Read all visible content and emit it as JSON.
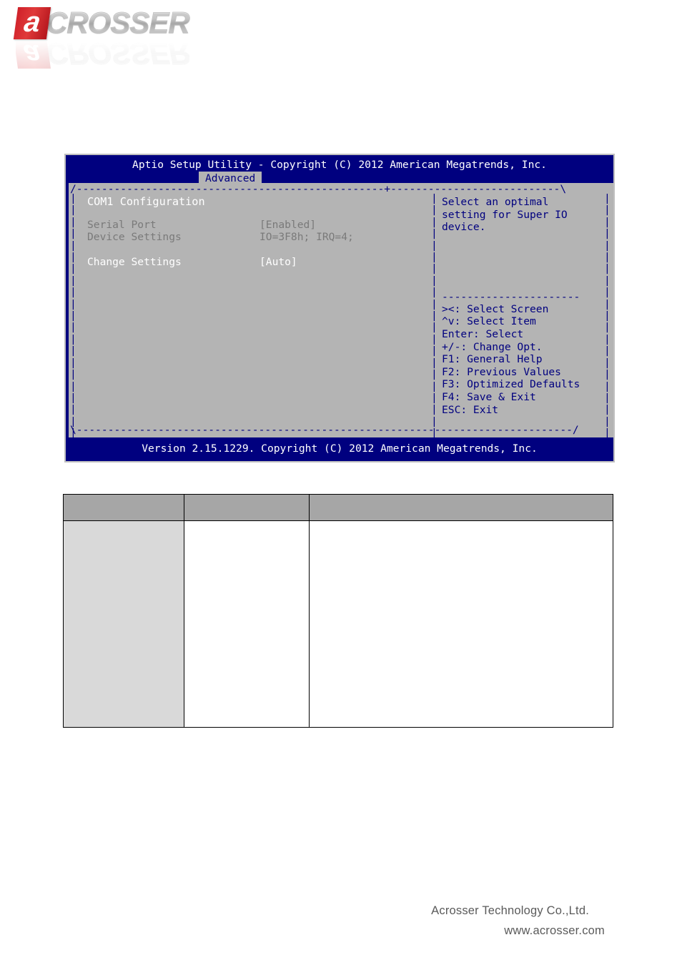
{
  "logo": {
    "mark_letter": "a",
    "wordmark": "CROSSER",
    "alt": "acrosser"
  },
  "bios": {
    "title": "Aptio Setup Utility - Copyright (C) 2012 American Megatrends, Inc.",
    "active_tab": "Advanced",
    "tabs": [
      "Advanced"
    ],
    "section_title": "COM1 Configuration",
    "options": [
      {
        "label": "Serial Port",
        "value": "[Enabled]",
        "state": "dim"
      },
      {
        "label": "Device Settings",
        "value": "IO=3F8h; IRQ=4;",
        "state": "dim"
      },
      {
        "label": "Change Settings",
        "value": "[Auto]",
        "state": "active"
      }
    ],
    "help_text": "Select an optimal\nsetting for Super IO\ndevice.",
    "nav_keys": [
      "><: Select Screen",
      "^v: Select Item",
      "Enter: Select",
      "+/-: Change Opt.",
      "F1: General Help",
      "F2: Previous Values",
      "F3: Optimized Defaults",
      "F4: Save & Exit",
      "ESC: Exit"
    ],
    "version": "Version 2.15.1229. Copyright (C) 2012 American Megatrends, Inc.",
    "frame": {
      "top": "/-------------------------------------------------+---------------------------\\",
      "bottom": "\\-------------------------------------------------------------------------------/",
      "vertical_cell": "|",
      "help_separator": "----------------------",
      "rows": 21
    },
    "colors": {
      "screen_bg": "#00007F",
      "panel_bg": "#B4B4B4",
      "text_active": "#FFFFFF",
      "text_dim": "#7A7A7A",
      "text_blue": "#00007F",
      "tab_bg": "#B4B4B4"
    }
  },
  "table": {
    "columns": [
      "",
      "",
      ""
    ],
    "header_cells": [
      "",
      "",
      ""
    ],
    "body_cells": [
      "",
      "",
      ""
    ]
  },
  "footer": {
    "company": "Acrosser Technology Co.,Ltd.",
    "website": "www.acrosser.com"
  }
}
